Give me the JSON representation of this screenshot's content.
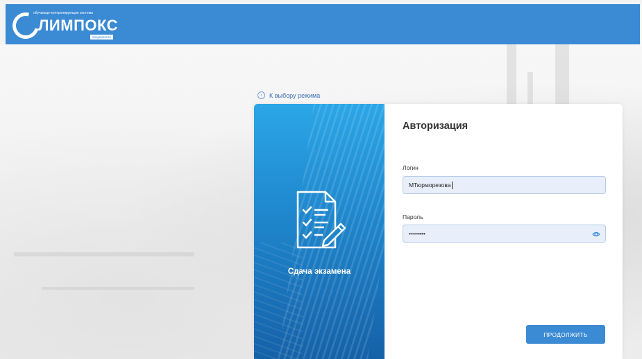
{
  "header": {
    "logo": {
      "tagline": "обучающе-контролирующая система",
      "name": "ЛИМПОКС",
      "sub": "предприятия"
    },
    "background_color": "#3a8ad4"
  },
  "back_link": {
    "label": "К выбору режима",
    "icon": "chevron-left-circle-icon"
  },
  "mode_panel": {
    "title": "Сдача экзамена",
    "icon": "exam-document-pencil-icon"
  },
  "auth": {
    "title": "Авторизация",
    "login": {
      "label": "Логин",
      "value": "МТюрморезова"
    },
    "password": {
      "label": "Пароль",
      "value": "••••••••",
      "toggle_icon": "eye-icon"
    },
    "submit_label": "ПРОДОЛЖИТЬ"
  },
  "colors": {
    "accent": "#3a8ad4",
    "input_bg": "#e8effb"
  }
}
